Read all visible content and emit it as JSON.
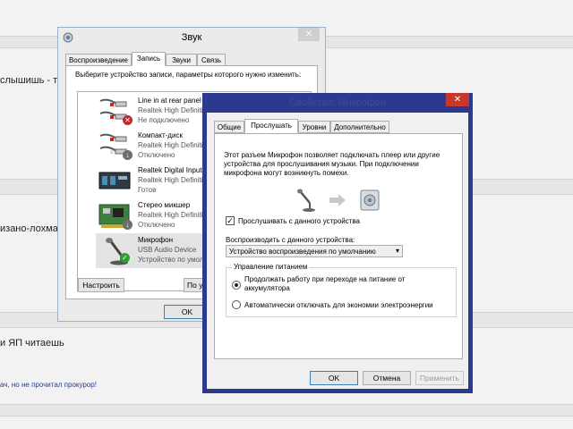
{
  "background": {
    "line1": "слышишь - та",
    "line2": "изано-лохма",
    "line3": "и ЯП читаешь",
    "link": "ач, но не прочитал прокурор!"
  },
  "sound_window": {
    "title": "Звук",
    "close": "✕",
    "tabs": [
      "Воспроизведение",
      "Запись",
      "Звуки",
      "Связь"
    ],
    "active_tab": 1,
    "instruction": "Выберите устройство записи, параметры которого нужно изменить:",
    "devices": [
      {
        "name": "Line in at rear panel (Ora",
        "driver": "Realtek High Definition A",
        "status": "Не подключено",
        "icon": "jack-cable-icon",
        "badge": "disconnected"
      },
      {
        "name": "Компакт-диск",
        "driver": "Realtek High Definition A",
        "status": "Отключено",
        "icon": "jack-cable-icon",
        "badge": "disabled"
      },
      {
        "name": "Realtek Digital Input",
        "driver": "Realtek High Definition A",
        "status": "Готов",
        "icon": "digital-input-icon",
        "badge": ""
      },
      {
        "name": "Стерео микшер",
        "driver": "Realtek High Definition A",
        "status": "Отключено",
        "icon": "sound-card-icon",
        "badge": "disabled"
      },
      {
        "name": "Микрофон",
        "driver": "USB Audio Device",
        "status": "Устройство по умолча",
        "icon": "microphone-icon",
        "badge": "default"
      }
    ],
    "configure_button": "Настроить",
    "properties_button": "По у",
    "ok_button": "OK"
  },
  "mic_window": {
    "title": "Свойства: Микрофон",
    "tabs": [
      "Общие",
      "Прослушать",
      "Уровни",
      "Дополнительно"
    ],
    "active_tab": 1,
    "description": "Этот разъем Микрофон позволяет подключать плеер или другие устройства для прослушивания музыки. При подключении микрофона могут возникнуть помехи.",
    "listen_checkbox_label": "Прослушивать с данного устройства",
    "listen_checked": true,
    "playback_label": "Воспроизводить с данного устройства:",
    "playback_selected": "Устройство воспроизведения по умолчанию",
    "power_group_label": "Управление питанием",
    "power_option_1": "Продолжать работу при переходе на питание от аккумулятора",
    "power_option_2": "Автоматически отключать для экономии электроэнергии",
    "power_selected": 0,
    "ok_button": "OK",
    "cancel_button": "Отмена",
    "apply_button": "Применить"
  }
}
